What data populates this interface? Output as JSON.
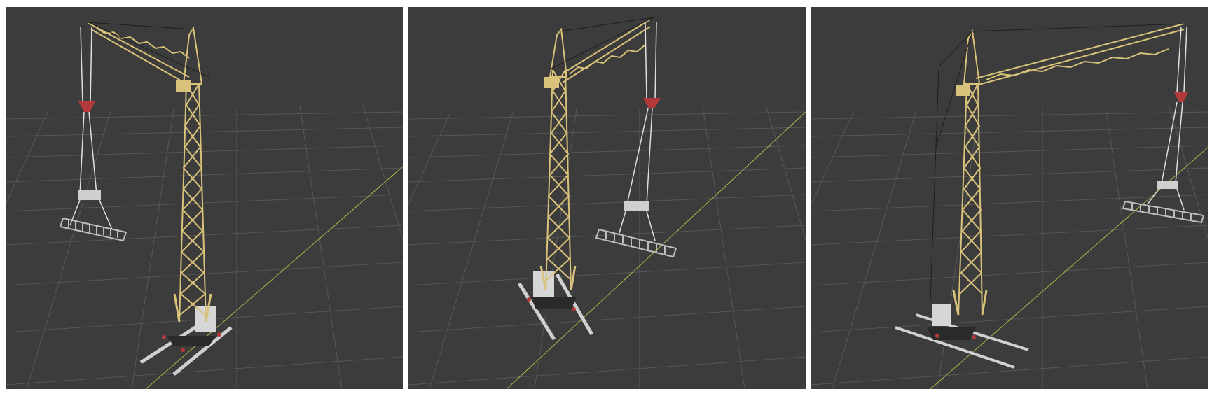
{
  "viewports": [
    {
      "label": "viewport-1",
      "pose": "jib-left"
    },
    {
      "label": "viewport-2",
      "pose": "jib-right"
    },
    {
      "label": "viewport-3",
      "pose": "jib-far-right"
    }
  ],
  "colors": {
    "viewport_background": "#3c3c3c",
    "grid_line": "#575757",
    "grid_axis": "#b8b84a",
    "crane_lattice": "#d9c27a",
    "crane_lattice_dark": "#a8914e",
    "rail": "#d0d0d0",
    "hook_block": "#b33a3a",
    "counterweight": "#d6d6d6",
    "load_frame": "#bdbdbd"
  },
  "scene": {
    "object": "tower-crane",
    "grid": true
  }
}
